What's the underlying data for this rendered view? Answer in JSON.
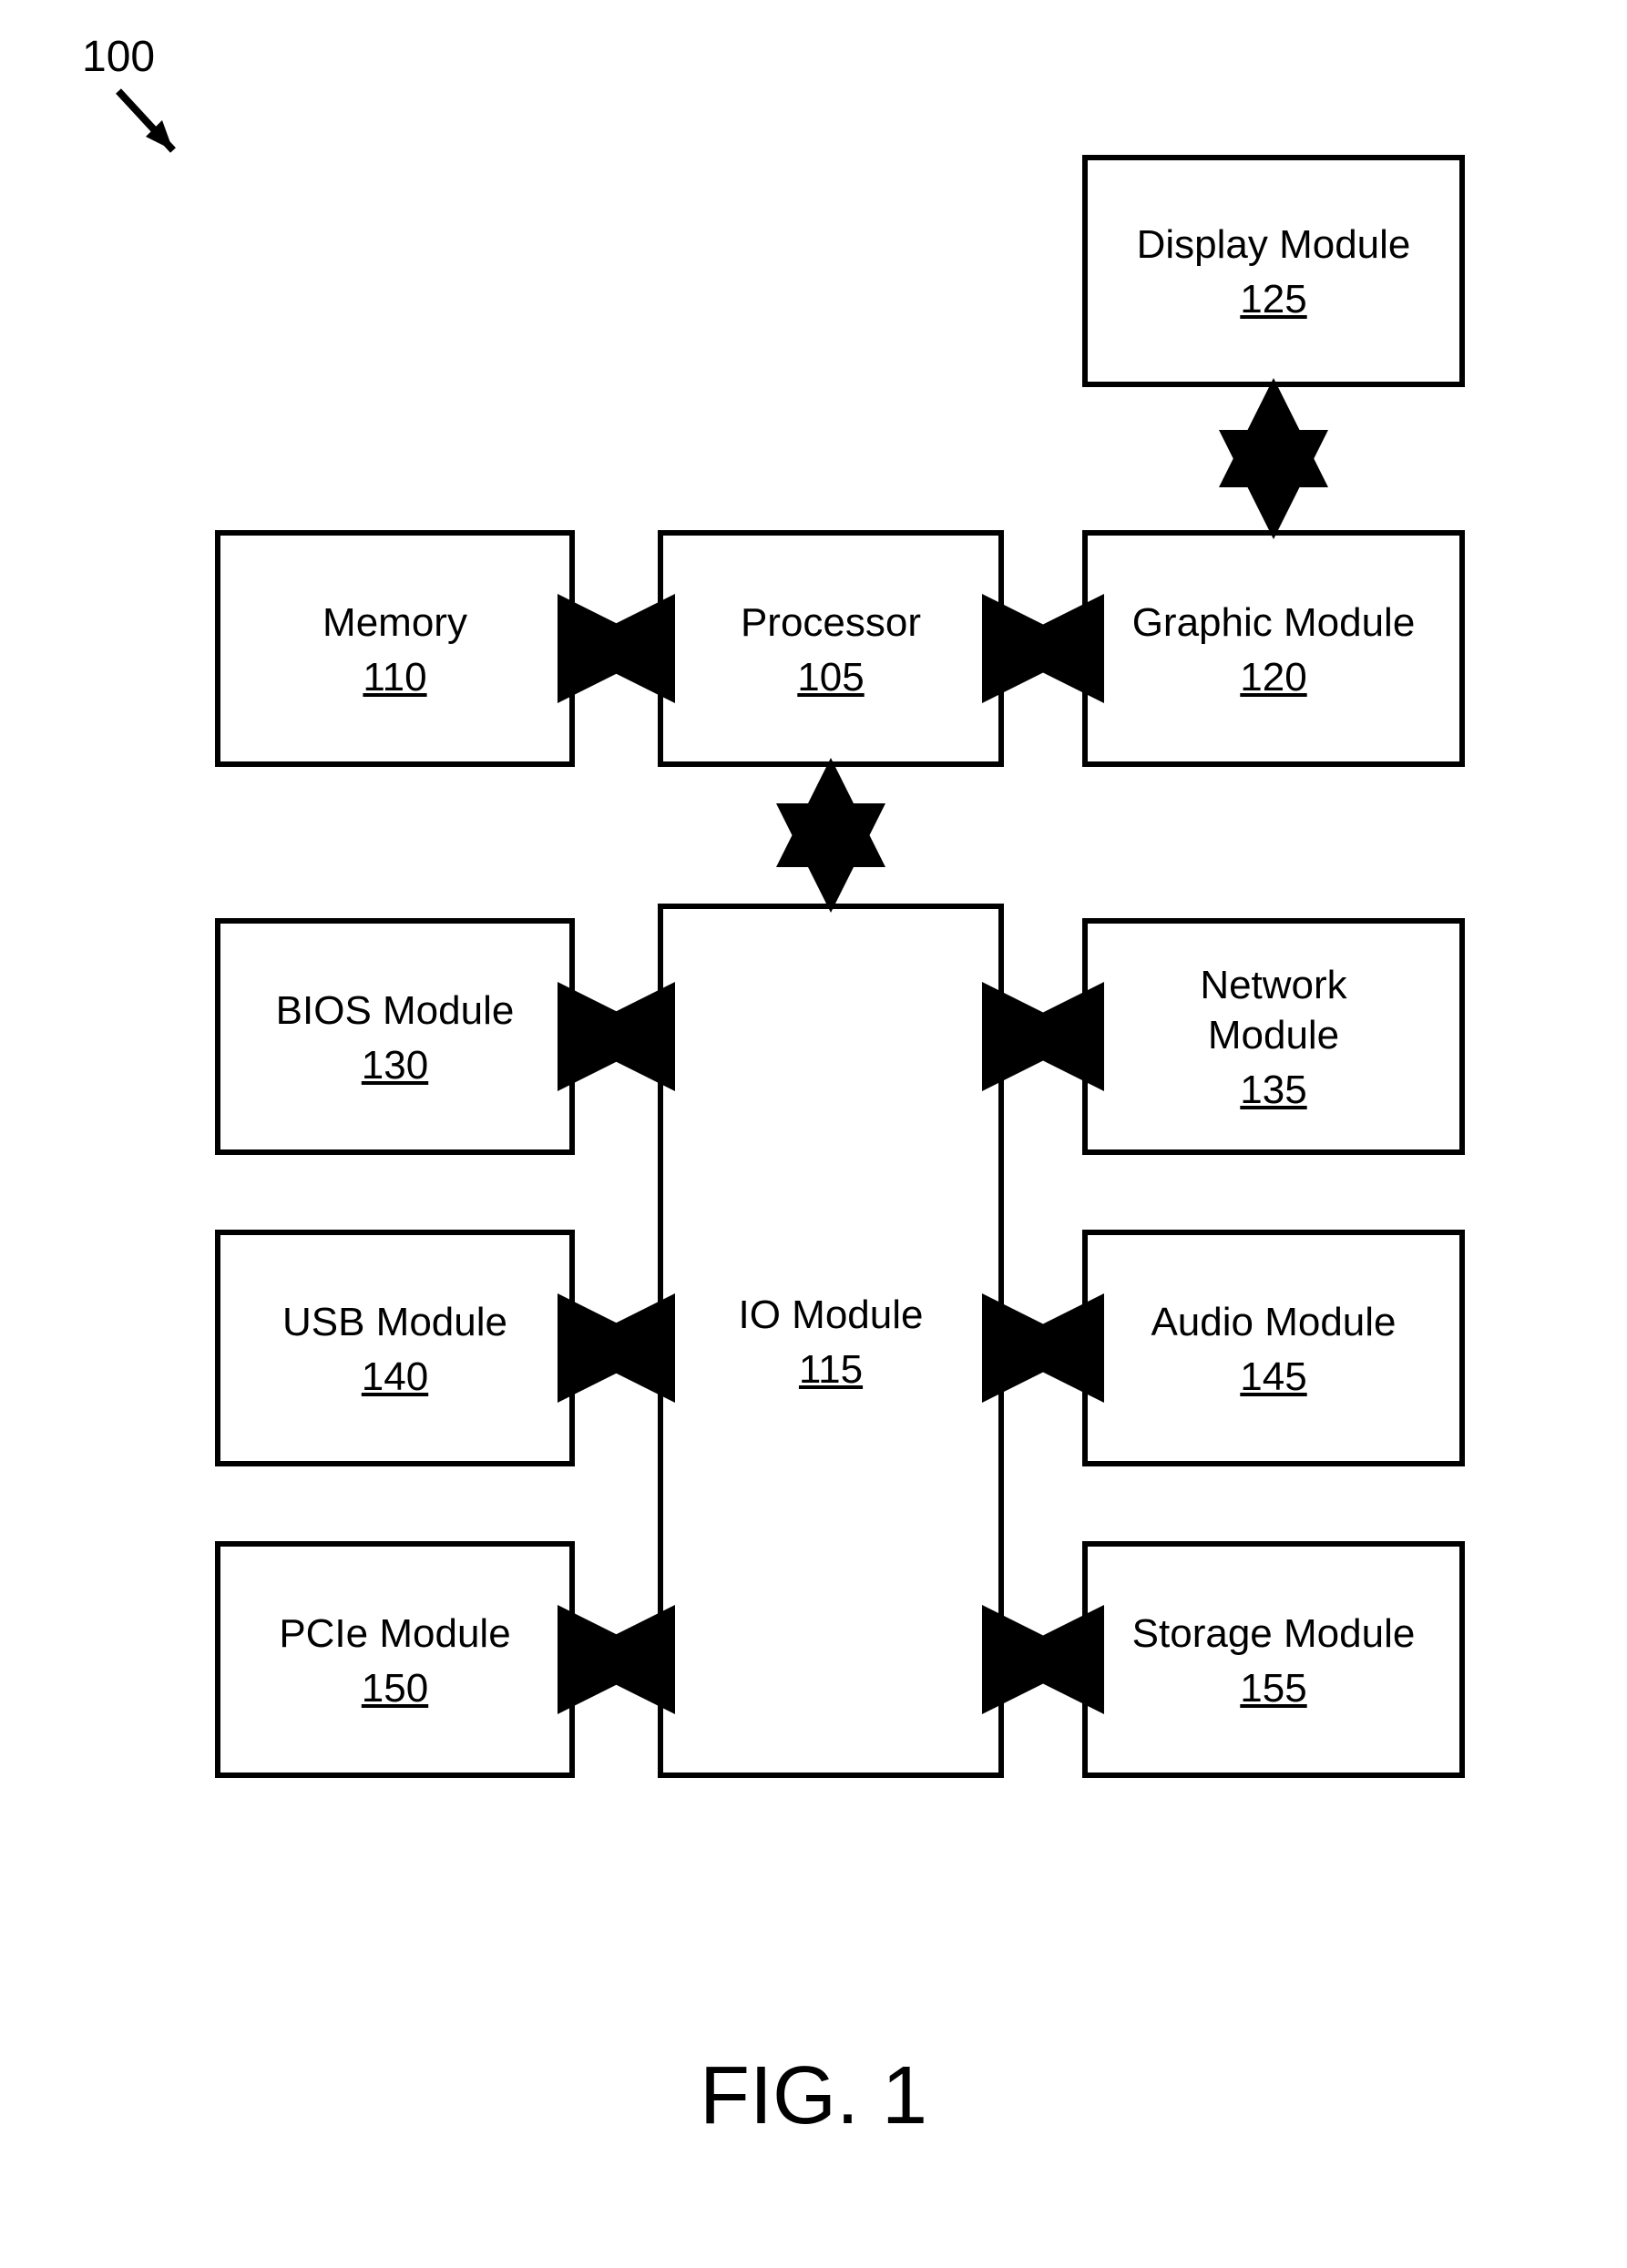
{
  "figure": {
    "ref_marker": "100",
    "caption": "FIG. 1"
  },
  "blocks": {
    "processor": {
      "label": "Processor",
      "ref": "105"
    },
    "memory": {
      "label": "Memory",
      "ref": "110"
    },
    "graphic_module": {
      "label": "Graphic Module",
      "ref": "120"
    },
    "display_module": {
      "label": "Display Module",
      "ref": "125"
    },
    "io_module": {
      "label": "IO Module",
      "ref": "115"
    },
    "bios_module": {
      "label": "BIOS Module",
      "ref": "130"
    },
    "network_module": {
      "label": "Network\nModule",
      "ref": "135"
    },
    "usb_module": {
      "label": "USB Module",
      "ref": "140"
    },
    "audio_module": {
      "label": "Audio Module",
      "ref": "145"
    },
    "pcie_module": {
      "label": "PCIe Module",
      "ref": "150"
    },
    "storage_module": {
      "label": "Storage Module",
      "ref": "155"
    }
  }
}
